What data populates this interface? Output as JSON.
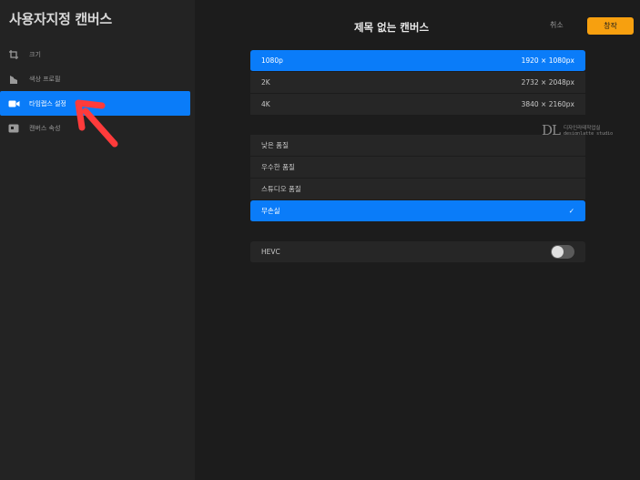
{
  "sidebar": {
    "title": "사용자지정 캔버스",
    "items": [
      {
        "label": "크기",
        "icon": "crop-icon"
      },
      {
        "label": "색상 프로필",
        "icon": "color-profile-icon"
      },
      {
        "label": "타임랩스 설정",
        "icon": "video-camera-icon",
        "active": true
      },
      {
        "label": "캔버스 속성",
        "icon": "canvas-properties-icon"
      }
    ]
  },
  "header": {
    "title": "제목 없는 캔버스",
    "cancel_label": "취소",
    "create_label": "창작"
  },
  "resolution": [
    {
      "name": "1080p",
      "size": "1920 × 1080px",
      "selected": true
    },
    {
      "name": "2K",
      "size": "2732 × 2048px"
    },
    {
      "name": "4K",
      "size": "3840 × 2160px"
    }
  ],
  "quality": [
    {
      "name": "낮은 품질"
    },
    {
      "name": "우수한 품질"
    },
    {
      "name": "스튜디오 품질"
    },
    {
      "name": "무손실",
      "selected": true,
      "check": "✓"
    }
  ],
  "hevc": {
    "label": "HEVC",
    "enabled": false
  },
  "watermark": {
    "logo": "DL",
    "line1": "디자인라테작업실",
    "line2": "designlatte studio"
  },
  "colors": {
    "accent": "#0a7cf9",
    "create": "#f7a00f",
    "annotation_arrow": "#ff3b3b"
  }
}
